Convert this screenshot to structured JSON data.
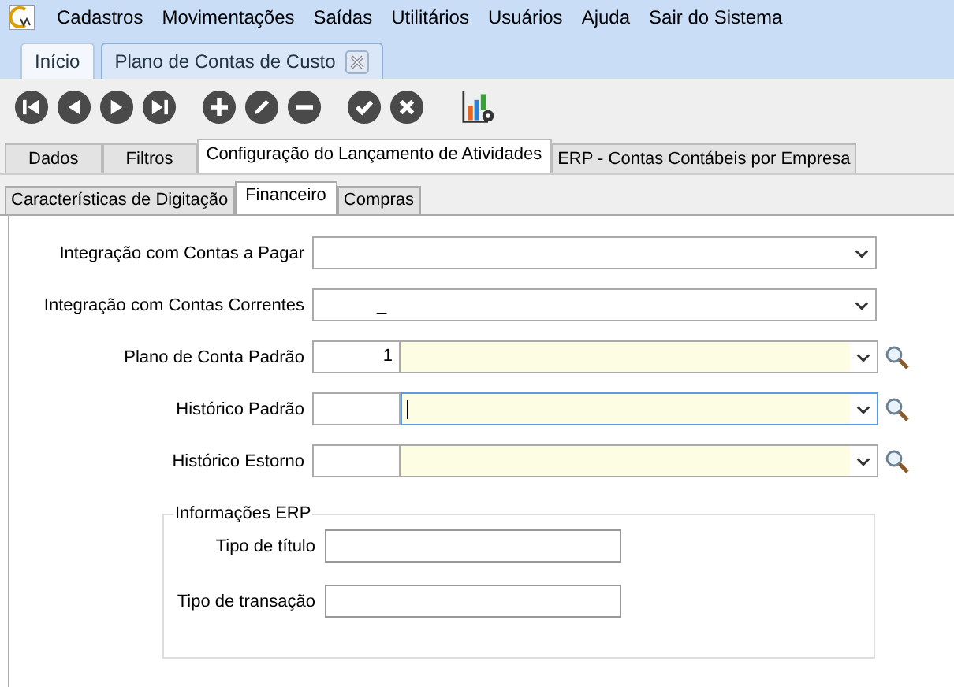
{
  "menu": [
    "Cadastros",
    "Movimentações",
    "Saídas",
    "Utilitários",
    "Usuários",
    "Ajuda",
    "Sair do Sistema"
  ],
  "doc_tabs": [
    {
      "label": "Início",
      "selected": false,
      "closable": false
    },
    {
      "label": "Plano de Contas de Custo",
      "selected": true,
      "closable": true
    }
  ],
  "tabs": [
    {
      "label": "Dados",
      "selected": false
    },
    {
      "label": "Filtros",
      "selected": false
    },
    {
      "label": "Configuração do Lançamento de Atividades",
      "selected": true
    },
    {
      "label": "ERP - Contas Contábeis por Empresa",
      "selected": false
    }
  ],
  "subtabs": [
    {
      "label": "Características de Digitação",
      "selected": false
    },
    {
      "label": "Financeiro",
      "selected": true
    },
    {
      "label": "Compras",
      "selected": false
    }
  ],
  "fields": [
    {
      "kind": "select",
      "label": "Integração com Contas a Pagar"
    },
    {
      "kind": "select",
      "label": "Integração com Contas Correntes",
      "value": "_"
    },
    {
      "kind": "lookup",
      "label": "Plano de Conta Padrão",
      "code": "1",
      "focused": false
    },
    {
      "kind": "lookup",
      "label": "Histórico Padrão",
      "focused": true
    },
    {
      "kind": "lookup",
      "label": "Histórico Estorno",
      "focused": false
    }
  ],
  "erp_group": {
    "title": "Informações ERP",
    "fields": [
      {
        "label": "Tipo de título"
      },
      {
        "label": "Tipo de transação"
      }
    ]
  }
}
